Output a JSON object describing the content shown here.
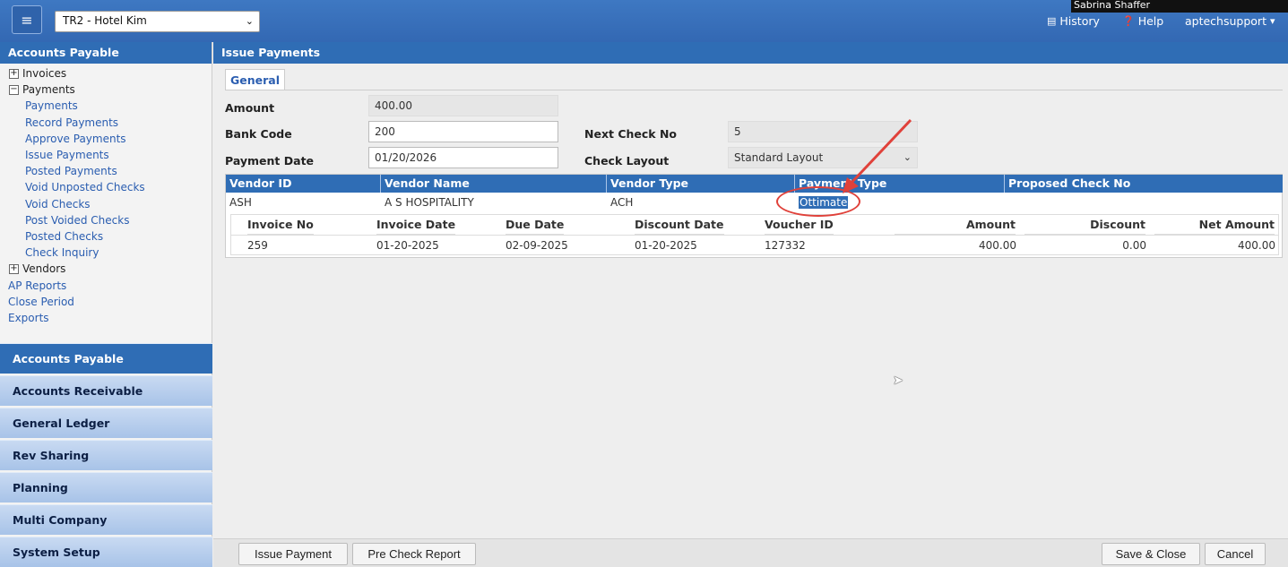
{
  "header": {
    "menu_icon": "hamburger-icon",
    "company": "TR2 - Hotel Kim",
    "history_label": "History",
    "help_label": "Help",
    "user_label": "aptechsupport",
    "video_overlay_name": "Sabrina Shaffer"
  },
  "sidebar": {
    "title": "Accounts Payable",
    "tree": {
      "invoices": "Invoices",
      "payments": "Payments",
      "payment_items": [
        "Payments",
        "Record Payments",
        "Approve Payments",
        "Issue Payments",
        "Posted Payments",
        "Void Unposted Checks",
        "Void Checks",
        "Post Voided Checks",
        "Posted Checks",
        "Check Inquiry"
      ],
      "vendors": "Vendors",
      "links": [
        "AP Reports",
        "Close Period",
        "Exports"
      ]
    },
    "modules": [
      "Accounts Payable",
      "Accounts Receivable",
      "General Ledger",
      "Rev Sharing",
      "Planning",
      "Multi Company",
      "System Setup"
    ]
  },
  "main": {
    "title": "Issue Payments",
    "tab": "General",
    "form": {
      "amount_label": "Amount",
      "amount_value": "400.00",
      "bank_code_label": "Bank Code",
      "bank_code_value": "200",
      "payment_date_label": "Payment Date",
      "payment_date_value": "01/20/2026",
      "next_check_label": "Next Check No",
      "next_check_value": "5",
      "check_layout_label": "Check Layout",
      "check_layout_value": "Standard Layout"
    },
    "vendor_grid": {
      "columns": [
        "Vendor ID",
        "Vendor Name",
        "Vendor Type",
        "Payment Type",
        "Proposed Check No"
      ],
      "row": {
        "vendor_id": "ASH",
        "vendor_name": "A S HOSPITALITY",
        "vendor_type": "ACH",
        "payment_type": "Ottimate",
        "proposed_check_no": ""
      }
    },
    "invoice_grid": {
      "columns": [
        "Invoice No",
        "Invoice Date",
        "Due Date",
        "Discount Date",
        "Voucher ID",
        "Amount",
        "Discount",
        "Net Amount"
      ],
      "row": {
        "invoice_no": "259",
        "invoice_date": "01-20-2025",
        "due_date": "02-09-2025",
        "discount_date": "01-20-2025",
        "voucher_id": "127332",
        "amount": "400.00",
        "discount": "0.00",
        "net_amount": "400.00"
      }
    }
  },
  "footer": {
    "issue_payment": "Issue Payment",
    "pre_check_report": "Pre Check Report",
    "save_close": "Save & Close",
    "cancel": "Cancel"
  },
  "colors": {
    "primary": "#2f6db5",
    "annotation": "#e0413a"
  }
}
